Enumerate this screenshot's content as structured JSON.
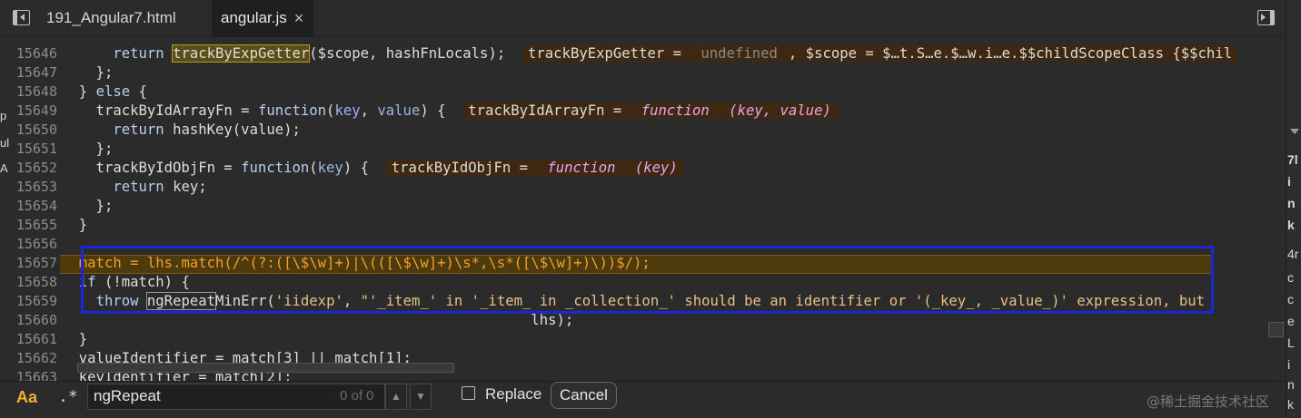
{
  "tabs": [
    {
      "label": "191_Angular7.html",
      "active": false
    },
    {
      "label": "angular.js",
      "active": true,
      "close_glyph": "×"
    }
  ],
  "editor": {
    "lines": [
      {
        "num": "15646",
        "tokens": [
          {
            "t": "      "
          },
          {
            "t": "return",
            "c": "kw"
          },
          {
            "t": " "
          },
          {
            "t": "trackByExpGetter",
            "c": "match-hl"
          },
          {
            "t": "($scope, hashFnLocals);  "
          },
          {
            "t": "trackByExpGetter = ",
            "c": "inline-val"
          },
          {
            "t": "undefined",
            "c": "inline-val iv-u"
          },
          {
            "t": ", $scope = $…t.S…e.$…w.i…e.$$childScopeClass {$$chil",
            "c": "inline-val"
          }
        ]
      },
      {
        "num": "15647",
        "tokens": [
          {
            "t": "    };"
          }
        ]
      },
      {
        "num": "15648",
        "tokens": [
          {
            "t": "  } "
          },
          {
            "t": "else",
            "c": "kw"
          },
          {
            "t": " {"
          }
        ]
      },
      {
        "num": "15649",
        "tokens": [
          {
            "t": "    trackByIdArrayFn = "
          },
          {
            "t": "function",
            "c": "kw"
          },
          {
            "t": "("
          },
          {
            "t": "key",
            "c": "fn"
          },
          {
            "t": ", "
          },
          {
            "t": "value",
            "c": "fn"
          },
          {
            "t": ") {  "
          },
          {
            "t": "trackByIdArrayFn = ",
            "c": "inline-val"
          },
          {
            "t": "function",
            "c": "inline-val iv-fn"
          },
          {
            "t": " (key, value)",
            "c": "inline-val iv-fn"
          }
        ]
      },
      {
        "num": "15650",
        "tokens": [
          {
            "t": "      "
          },
          {
            "t": "return",
            "c": "kw"
          },
          {
            "t": " hashKey(value);"
          }
        ]
      },
      {
        "num": "15651",
        "tokens": [
          {
            "t": "    };"
          }
        ]
      },
      {
        "num": "15652",
        "tokens": [
          {
            "t": "    trackByIdObjFn = "
          },
          {
            "t": "function",
            "c": "kw"
          },
          {
            "t": "("
          },
          {
            "t": "key",
            "c": "fn"
          },
          {
            "t": ") {  "
          },
          {
            "t": "trackByIdObjFn = ",
            "c": "inline-val"
          },
          {
            "t": "function",
            "c": "inline-val iv-fn"
          },
          {
            "t": " (key)",
            "c": "inline-val iv-fn"
          }
        ]
      },
      {
        "num": "15653",
        "tokens": [
          {
            "t": "      "
          },
          {
            "t": "return",
            "c": "kw"
          },
          {
            "t": " key;"
          }
        ]
      },
      {
        "num": "15654",
        "tokens": [
          {
            "t": "    };"
          }
        ]
      },
      {
        "num": "15655",
        "tokens": [
          {
            "t": "  }"
          }
        ]
      },
      {
        "num": "15656",
        "tokens": [
          {
            "t": ""
          }
        ]
      },
      {
        "num": "15657",
        "tokens": [
          {
            "t": "  match = lhs.",
            "c": "rx"
          },
          {
            "t": "match",
            "c": "rx"
          },
          {
            "t": "(/^(?:([\\$\\w]+)|\\(([\\$\\w]+)\\s*,\\s*([\\$\\w]+)\\))$/);",
            "c": "rx"
          }
        ]
      },
      {
        "num": "15658",
        "tokens": [
          {
            "t": "  "
          },
          {
            "t": "if",
            "c": "kw"
          },
          {
            "t": " (!match) {"
          }
        ]
      },
      {
        "num": "15659",
        "tokens": [
          {
            "t": "    "
          },
          {
            "t": "throw",
            "c": "kw"
          },
          {
            "t": " "
          },
          {
            "t": "ngRepeat",
            "c": "find-hl"
          },
          {
            "t": "MinErr("
          },
          {
            "t": "'iidexp'",
            "c": "s"
          },
          {
            "t": ", "
          },
          {
            "t": "\"'_item_' in '_item_ in _collection_' should be an identifier or '(_key_, _value_)' expression, but",
            "c": "s"
          }
        ]
      },
      {
        "num": "15660",
        "tokens": [
          {
            "t": "                                                       lhs);"
          }
        ]
      },
      {
        "num": "15661",
        "tokens": [
          {
            "t": "  }"
          }
        ]
      },
      {
        "num": "15662",
        "tokens": [
          {
            "t": "  valueIdentifier = match[3] || match[1];"
          }
        ]
      },
      {
        "num": "15663",
        "tokens": [
          {
            "t": "  keyIdentifier = match[2];"
          }
        ]
      }
    ]
  },
  "findbar": {
    "case_label": "Aa",
    "regex_label": ".*",
    "search_value": "ngRepeat",
    "count": "0 of 0",
    "replace_label": "Replace",
    "cancel_label": "Cancel"
  },
  "watermark": "@稀土掘金技术社区",
  "right_panel_chars": [
    "7l",
    "i",
    "n",
    "k",
    "4r",
    "c",
    "c",
    "e",
    "L",
    "i",
    "n",
    "k"
  ],
  "left_peek_chars": [
    "p",
    "ul",
    "A"
  ]
}
